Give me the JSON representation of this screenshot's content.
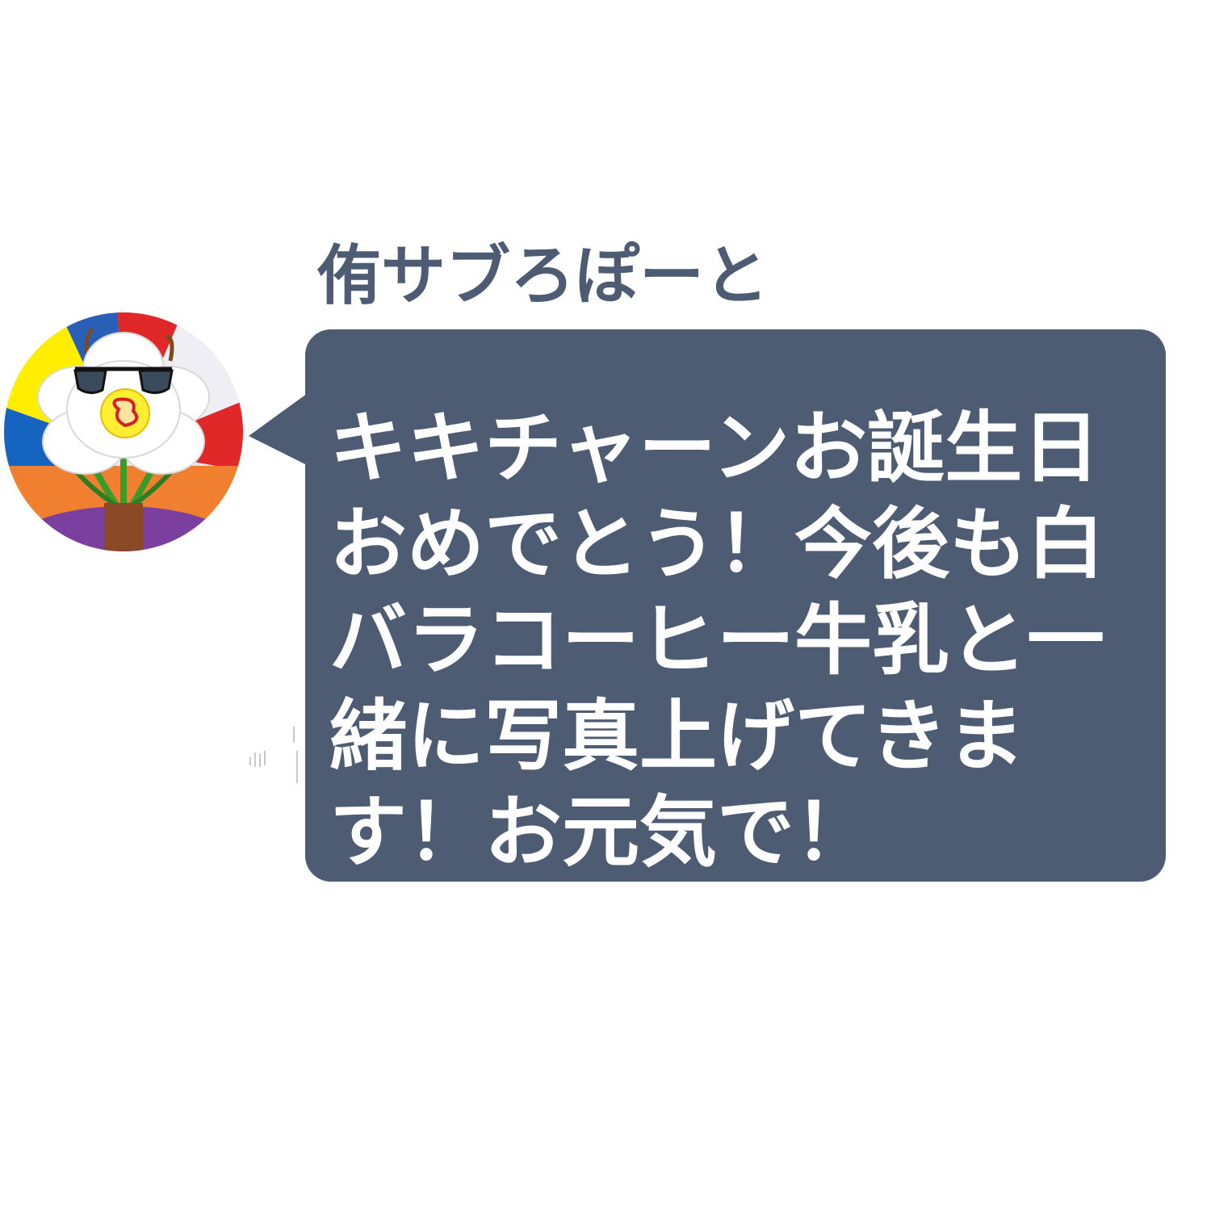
{
  "colors": {
    "background": "#ffffff",
    "bubble": "#4d5b73",
    "sender_name": "#4d5b73",
    "message_text": "#ffffff"
  },
  "message": {
    "sender_name": "侑サブろぽーと",
    "avatar_icon": "white-flower-with-sunglasses-icon",
    "text": "キキチャーンお誕生日おめでとう！今後も白バラコーヒー牛乳と一緒に写真上げてきます！お元気で！"
  }
}
